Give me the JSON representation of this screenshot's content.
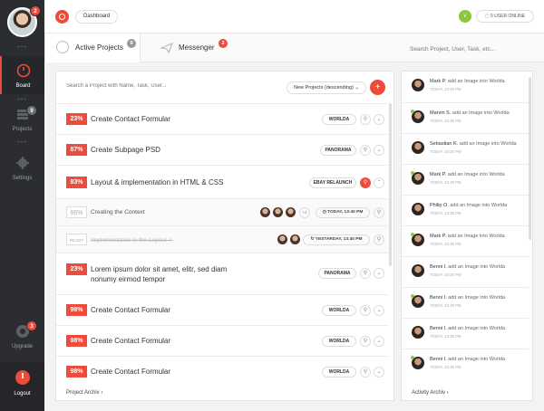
{
  "user": {
    "notifications": "2"
  },
  "sidebar": {
    "items": [
      {
        "label": "Board"
      },
      {
        "label": "Projects",
        "badge": "9"
      },
      {
        "label": "Settings"
      },
      {
        "label": "Upgrade",
        "badge": "3"
      },
      {
        "label": "Logout"
      }
    ]
  },
  "topbar": {
    "breadcrumb": "Dashboard",
    "online_count": "v",
    "online_label": "5 USER ONLINE"
  },
  "tabs": [
    {
      "label": "Active Projects",
      "badge": "9"
    },
    {
      "label": "Messenger",
      "badge": "2"
    }
  ],
  "search": {
    "placeholder": "Search Project, User, Task, etc..."
  },
  "projects": {
    "search_placeholder": "Search a Project with Name, Task, User...",
    "sort_label": "New Projects (descending)",
    "add_label": "+",
    "footer_link": "Project Archiv",
    "rows": [
      {
        "pct": "23%",
        "title": "Create Contact Formular",
        "tag": "WORLDA"
      },
      {
        "pct": "87%",
        "title": "Create Subpage PSD",
        "tag": "PANORAMA"
      },
      {
        "pct": "83%",
        "title": "Layout & implementation in HTML & CSS",
        "tag": "EBAY RELAUNCH"
      },
      {
        "pct": "66%",
        "title": "Creating the Context",
        "more": "+4",
        "date": "TODAY, 13:40 PM"
      },
      {
        "pct": "READY",
        "title": "Implementation in the Layout ✓",
        "date": "YESTARDAY, 13:40 PM"
      },
      {
        "pct": "23%",
        "title": "Lorem ipsum dolor sit amet, elitr, sed diam nonumy eirmod tempor",
        "tag": "PANORAMA"
      },
      {
        "pct": "98%",
        "title": "Create Contact Formular",
        "tag": "WORLDA"
      },
      {
        "pct": "98%",
        "title": "Create Contact Formular",
        "tag": "WORLDA"
      },
      {
        "pct": "98%",
        "title": "Create Contact Formular",
        "tag": "WORLDA"
      }
    ]
  },
  "activity": {
    "footer_link": "Activity Archiv",
    "items": [
      {
        "name": "Mark P.",
        "action": "add an Image into Worlda",
        "time": "TODAY, 10:30 PM"
      },
      {
        "name": "Marvin S.",
        "action": "add an Image into Worlda",
        "time": "TODAY, 10:30 PM"
      },
      {
        "name": "Sebastian K.",
        "action": "add an Image into Worlda",
        "time": "TODAY, 10:30 PM"
      },
      {
        "name": "Mark P.",
        "action": "add an Image into Worlda",
        "time": "TODAY, 10:30 PM"
      },
      {
        "name": "Philip O.",
        "action": "add an Image into Worlda",
        "time": "TODAY, 10:30 PM"
      },
      {
        "name": "Mark P.",
        "action": "add an Image into Worlda",
        "time": "TODAY, 10:30 PM"
      },
      {
        "name": "Benni I.",
        "action": "add an Image into Worlda",
        "time": "TODAY, 10:30 PM"
      },
      {
        "name": "Benni I.",
        "action": "add an Image into Worlda",
        "time": "TODAY, 10:30 PM"
      },
      {
        "name": "Benni I.",
        "action": "add an Image into Worlda",
        "time": "TODAY, 10:30 PM"
      },
      {
        "name": "Benni I.",
        "action": "add an Image into Worlda",
        "time": "TODAY, 10:30 PM"
      }
    ]
  },
  "colors": {
    "accent": "#ee4b3b",
    "online": "#8cc63f",
    "sidebar": "#2b2d30"
  }
}
